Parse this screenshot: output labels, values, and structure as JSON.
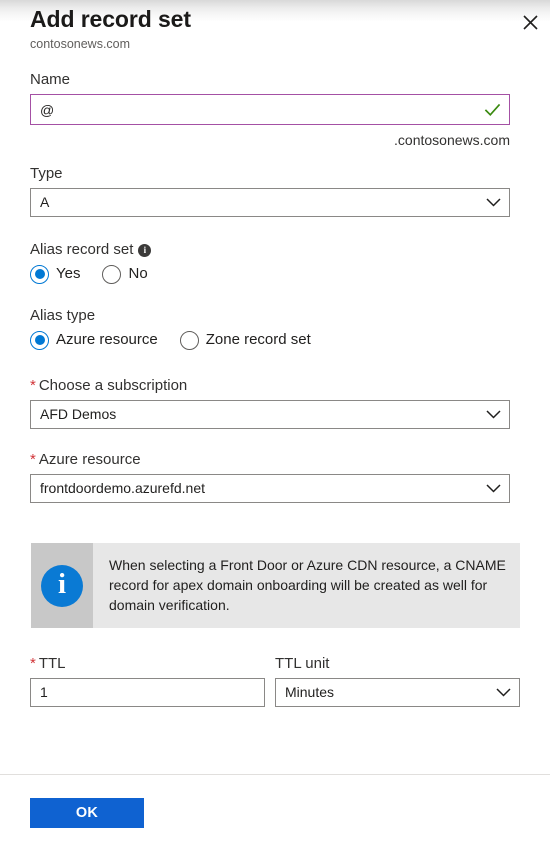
{
  "header": {
    "title": "Add record set",
    "subtitle": "contosonews.com",
    "close_label": "Close",
    "close_icon": "close-icon"
  },
  "name_field": {
    "label": "Name",
    "value": "@",
    "placeholder": "",
    "suffix": ".contosonews.com",
    "validation_icon": "checkmark-icon",
    "validation_color": "#3a8a10",
    "border_color": "#a450a4"
  },
  "type_field": {
    "label": "Type",
    "value": "A",
    "chevron_icon": "chevron-down-icon"
  },
  "alias_record_set": {
    "label": "Alias record set",
    "info_icon": "info-icon",
    "selected": "Yes",
    "options": [
      {
        "label": "Yes",
        "checked": true
      },
      {
        "label": "No",
        "checked": false
      }
    ]
  },
  "alias_type": {
    "label": "Alias type",
    "selected": "Azure resource",
    "options": [
      {
        "label": "Azure resource",
        "checked": true
      },
      {
        "label": "Zone record set",
        "checked": false
      }
    ]
  },
  "subscription_field": {
    "required": true,
    "required_marker": "*",
    "label": "Choose a subscription",
    "value": "AFD Demos",
    "chevron_icon": "chevron-down-icon"
  },
  "azure_resource_field": {
    "required": true,
    "required_marker": "*",
    "label": "Azure resource",
    "value": "frontdoordemo.azurefd.net",
    "chevron_icon": "chevron-down-icon"
  },
  "info_banner": {
    "icon": "info-icon",
    "icon_glyph": "i",
    "icon_color": "#0a7ad4",
    "icon_bg": "#c8c8c8",
    "bg": "#e7e7e7",
    "text": "When selecting a Front Door or Azure CDN resource, a CNAME record for apex domain onboarding will be created as well for domain verification."
  },
  "ttl_field": {
    "required": true,
    "required_marker": "*",
    "label": "TTL",
    "value": "1"
  },
  "ttl_unit_field": {
    "label": "TTL unit",
    "value": "Minutes",
    "chevron_icon": "chevron-down-icon"
  },
  "footer": {
    "ok_label": "OK",
    "ok_color": "#0f62d1"
  }
}
